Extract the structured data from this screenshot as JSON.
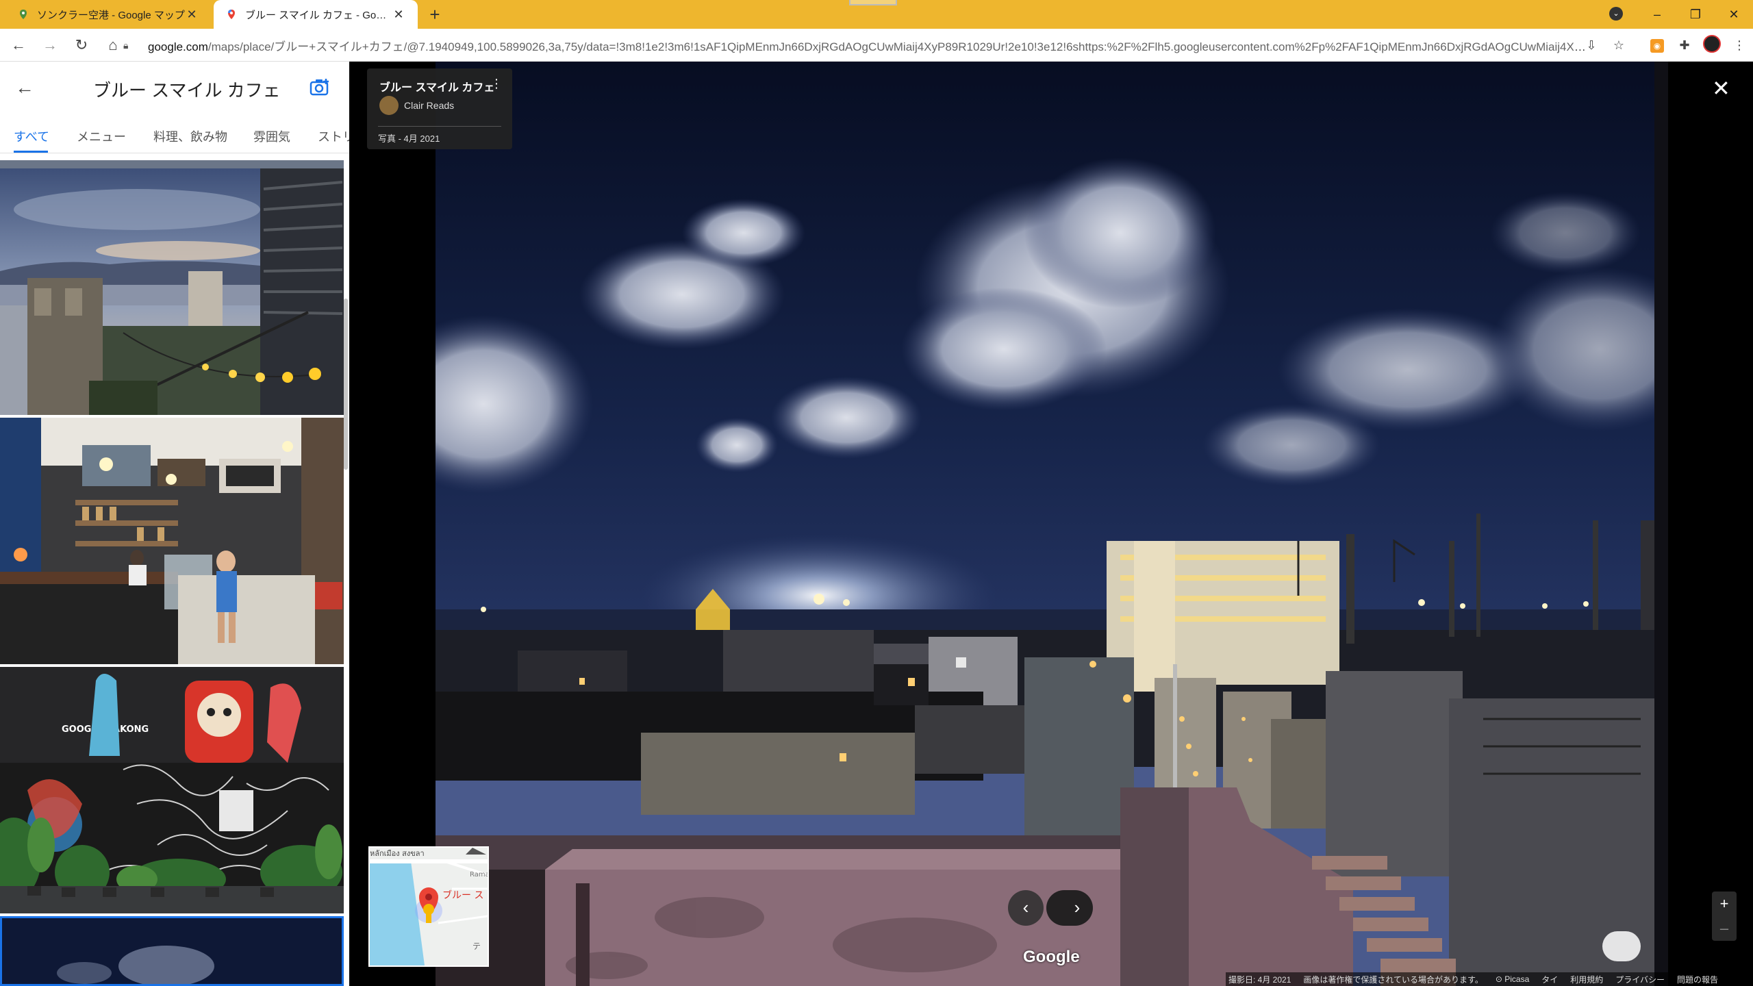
{
  "browser": {
    "tabs": [
      {
        "title": "ソンクラー空港 - Google マップ",
        "active": false
      },
      {
        "title": "ブルー スマイル カフェ - Google マップ",
        "active": true
      }
    ],
    "new_tab": "+",
    "url_host": "google.com",
    "url_rest": "/maps/place/ブルー+スマイル+カフェ/@7.1940949,100.5899026,3a,75y/data=!3m8!1e2!3m6!1sAF1QipMEnmJn66DxjRGdAOgCUwMiaij4XyP89R1029Ur!2e10!3e12!6shttps:%2F%2Flh5.googleusercontent.com%2Fp%2FAF1QipMEnmJn66DxjRGdAOgCUwMiaij4XyP..."
  },
  "panel": {
    "title": "ブルー スマイル カフェ",
    "tabs": [
      "すべて",
      "メニュー",
      "料理、飲み物",
      "雰囲気",
      "ストリ"
    ]
  },
  "viewer": {
    "place_name": "ブルー スマイル カフェ",
    "author": "Clair Reads",
    "date": "写真 - 4月 2021",
    "logo": "Google",
    "minimap": {
      "street_label": "หลักเมือง สงขลา",
      "road_label": "Rama",
      "pin_label": "ブルー ス",
      "letter": "テ"
    },
    "footer": [
      "撮影日: 4月 2021",
      "画像は著作権で保護されている場合があります。",
      "Picasa",
      "タイ",
      "利用規約",
      "プライバシー",
      "問題の報告"
    ],
    "wall_text": "GOOGLE BAKONG"
  },
  "colors": {
    "tabbar": "#eeb62e",
    "accent": "#1a73e8"
  }
}
